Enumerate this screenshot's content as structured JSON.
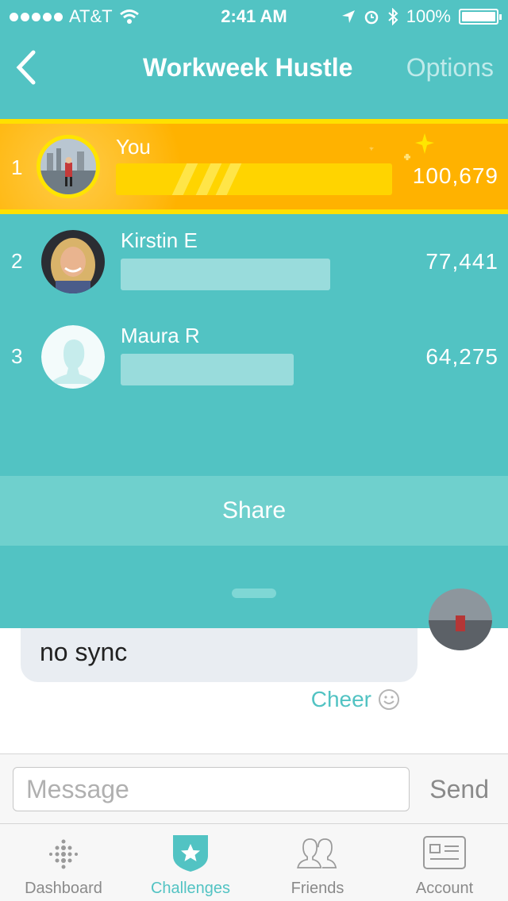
{
  "status_bar": {
    "carrier": "AT&T",
    "time": "2:41 AM",
    "battery": "100%"
  },
  "header": {
    "title": "Workweek Hustle",
    "options_label": "Options"
  },
  "leaderboard": [
    {
      "rank": "1",
      "name": "You",
      "steps": "100,679",
      "progress": 1.0
    },
    {
      "rank": "2",
      "name": "Kirstin E",
      "steps": "77,441",
      "progress": 0.77
    },
    {
      "rank": "3",
      "name": "Maura R",
      "steps": "64,275",
      "progress": 0.64
    }
  ],
  "share_label": "Share",
  "chat": {
    "message_text": "no sync",
    "cheer_label": "Cheer"
  },
  "composer": {
    "placeholder": "Message",
    "send_label": "Send"
  },
  "tabs": [
    {
      "label": "Dashboard",
      "icon": "dashboard-icon"
    },
    {
      "label": "Challenges",
      "icon": "challenges-star-icon",
      "active": true
    },
    {
      "label": "Friends",
      "icon": "friends-icon"
    },
    {
      "label": "Account",
      "icon": "account-card-icon"
    }
  ],
  "colors": {
    "teal": "#52c3c3",
    "gold": "#ffb200",
    "yellow": "#ffd400"
  }
}
